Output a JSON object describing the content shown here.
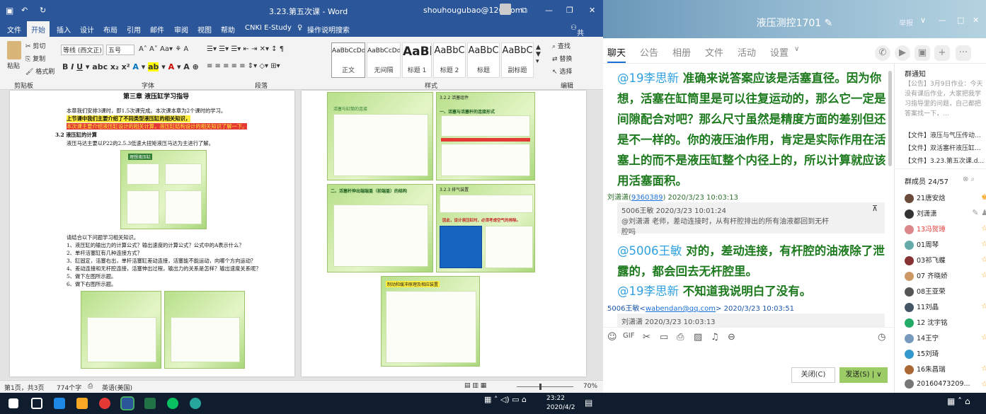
{
  "word": {
    "title": "3.23.第五次课 - Word",
    "account": "shouhougubao@126.com",
    "tabs": [
      "文件",
      "开始",
      "插入",
      "设计",
      "布局",
      "引用",
      "邮件",
      "审阅",
      "视图",
      "帮助",
      "CNKI E-Study",
      "操作说明搜索"
    ],
    "share": "共享",
    "clipboard": {
      "cut": "剪切",
      "copy": "复制",
      "paste": "粘贴",
      "format_painter": "格式刷",
      "group": "剪贴板"
    },
    "font": {
      "name": "等线 (西文正)",
      "size": "五号",
      "group": "字体"
    },
    "paragraph_group": "段落",
    "styles": [
      {
        "preview": "AaBbCcDd",
        "name": "正文"
      },
      {
        "preview": "AaBbCcDd",
        "name": "无间隔"
      },
      {
        "preview": "AaBl",
        "name": "标题 1"
      },
      {
        "preview": "AaBbC",
        "name": "标题 2"
      },
      {
        "preview": "AaBbC",
        "name": "标题"
      },
      {
        "preview": "AaBbC",
        "name": "副标题"
      }
    ],
    "styles_group": "样式",
    "editing": {
      "find": "查找",
      "replace": "替换",
      "select": "选择",
      "group": "编辑"
    },
    "page1": {
      "chapter": "第三章    液压缸学习指导",
      "lines": [
        "本章我们安排3课时，即1.5次课完成。本次课本章为2个课时的学习。",
        "上节课中我们主要介绍了不同类型液压缸的相关知识，",
        "本次课主要介绍液压缸设计的相关计算，液压缸结构设计的相关知识了解一下。",
        "3.2  液压缸的计算",
        "液压马达主要以P22的2.5.3低速大扭矩液压马达为主进行了解。"
      ],
      "questions_intro": "请结合以下问题学习相关知识。",
      "questions": [
        "1、液压缸的输出力的计算公式？输出速度的计算公式？公式中的A表示什么？",
        "2、单杆活塞缸有几种连接方式？",
        "3、缸固定，活塞右出，单杆活塞缸差动连接，活塞能不能运动，向哪个方向运动？",
        "4、差动连接和无杆腔连接，活塞伸出过程，输出力的关系是怎样？输出速度关系呢？",
        "5、做下左图所示题。",
        "6、做下右图所示题。"
      ],
      "figure_title": "理想液压缸"
    },
    "page2": {
      "labels": [
        "活塞与缸筒的连接",
        "3.2.2 活塞组件",
        "一、活塞与活塞杆的连接形式",
        "二、活塞杆伸出端端盖（前端盖）的结构",
        "3.2.3 排气装置",
        "因此，设计液压缸时，必须考虑空气的排除。",
        "制动和缓冲原理及相应装置"
      ]
    },
    "status": {
      "page": "第1页，共3页",
      "words": "774个字",
      "lang": "英语(美国)",
      "zoom": "70%"
    }
  },
  "taskbar": {
    "time": "23:22",
    "date": "2020/4/2"
  },
  "qq": {
    "title": "液压测控1701",
    "report": "举报",
    "tabs": [
      "聊天",
      "公告",
      "相册",
      "文件",
      "活动",
      "设置"
    ],
    "messages": [
      {
        "text": "准确来说答案应该是活塞直径。因为你想，活塞在缸筒里是可以往复运动的，那么它一定是间隙配合对吧？那么尺寸虽然是精度方面的差别但还是不一样的。你的液压油作用，肯定是实际作用在活塞上的而不是液压缸整个内径上的，所以计算就应该用活塞面积。",
        "mention": "@19李思新"
      },
      {
        "meta_name": "刘潇潇",
        "meta_id": "9360389",
        "meta_time": "2020/3/23 10:03:13"
      },
      {
        "quote_head": "5006王敏  2020/3/23 10:01:24",
        "quote_body": "@刘潇潇 老师，差动连接时，从有杆腔排出的所有油液都回到无杆腔吗"
      },
      {
        "mention": "@5006王敏",
        "text": "对的，差动连接，有杆腔的油液除了泄露的，都会回去无杆腔里。"
      },
      {
        "mention": "@19李思新",
        "text": "不知道我说明白了没有。"
      },
      {
        "meta_name": "5006王敏",
        "meta_email": "wabendan@qq.com",
        "meta_time": "2020/3/23 10:03:51"
      },
      {
        "quote_head": "刘潇潇  2020/3/23 10:03:13"
      }
    ],
    "close_label": "关闭(C)",
    "send_label": "发送(S)",
    "notice_title": "群通知",
    "notice_text": "【公告】3月9日作业：今天没有课后作业，大家把我学习指导里的问题，自己都把答案找一下，...",
    "files": [
      "【文件】液压与气压传动...",
      "【文件】双活塞杆液压缸...",
      "【文件】3.23.第五次课.d..."
    ],
    "members_label": "群成员 24/57",
    "members": [
      {
        "name": "21唐安焓",
        "color": "#222",
        "avatar": "#6b4c3b",
        "badge": "owner"
      },
      {
        "name": "刘潇潇",
        "color": "#222",
        "avatar": "#333",
        "badge": "admin"
      },
      {
        "name": "13冯贺璋",
        "color": "#e53935",
        "avatar": "#d88",
        "badge": "star"
      },
      {
        "name": "01周琴",
        "color": "#222",
        "avatar": "#6aa",
        "badge": "star"
      },
      {
        "name": "03祁飞蝶",
        "color": "#222",
        "avatar": "#833",
        "badge": "star"
      },
      {
        "name": "07 齐晓娇",
        "color": "#222",
        "avatar": "#c96",
        "badge": "star"
      },
      {
        "name": "08王亚荣",
        "color": "#222",
        "avatar": "#555",
        "badge": "none"
      },
      {
        "name": "11刘晶",
        "color": "#222",
        "avatar": "#456",
        "badge": "star"
      },
      {
        "name": "12 沈宇铭",
        "color": "#222",
        "avatar": "#2a6",
        "badge": "none"
      },
      {
        "name": "14王宁",
        "color": "#222",
        "avatar": "#79b",
        "badge": "star"
      },
      {
        "name": "15刘琦",
        "color": "#222",
        "avatar": "#39c",
        "badge": "none"
      },
      {
        "name": "16朱昌瑞",
        "color": "#222",
        "avatar": "#a63",
        "badge": "star"
      },
      {
        "name": "20160473209...",
        "color": "#222",
        "avatar": "#777",
        "badge": "star"
      }
    ]
  }
}
